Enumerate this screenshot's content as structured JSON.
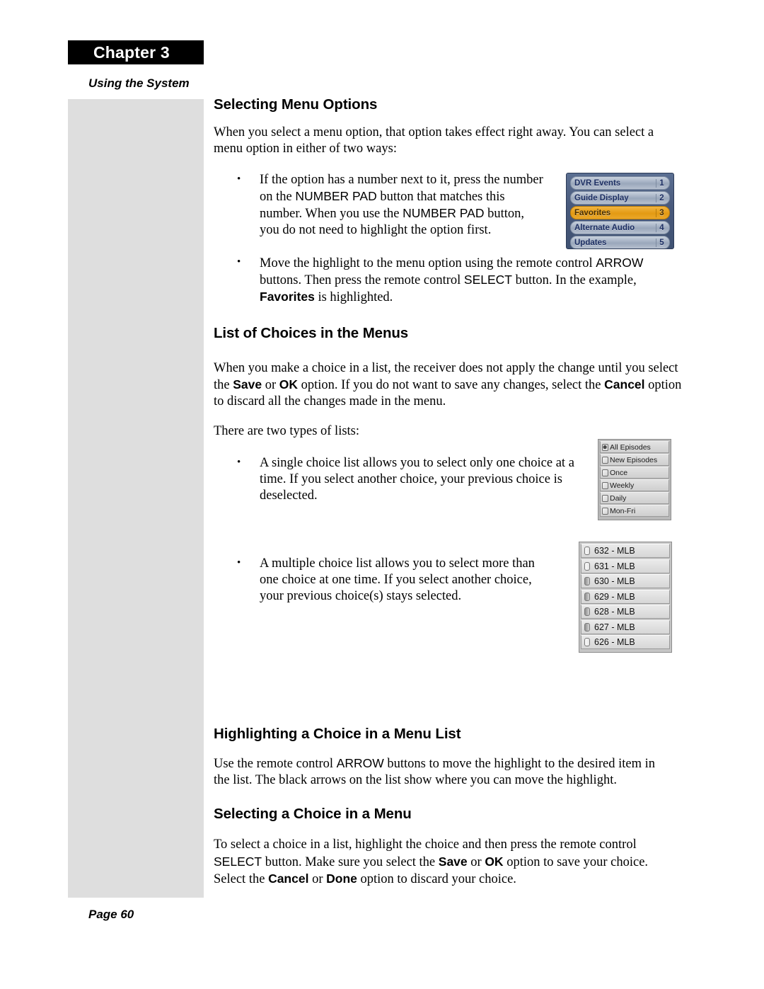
{
  "chapter": {
    "banner_label": "Chapter 3",
    "subtitle": "Using the System"
  },
  "footer": {
    "page_label": "Page 60"
  },
  "sections": {
    "selecting_menu_options": {
      "heading": "Selecting Menu Options",
      "intro": "When you select a menu option, that option takes effect right away. You can select a menu option in either of two ways:",
      "bullet1": {
        "part1": "If the option has a number next to it, press the number on the ",
        "emph1": "NUMBER PAD",
        "part2": " button that matches this number. When you use the ",
        "emph2": "NUMBER PAD",
        "part3": " button, you do not need to highlight the option first."
      },
      "bullet2": {
        "part1": "Move the highlight to the menu option using the remote control ",
        "emph1": "ARROW",
        "part2": " buttons. Then press the remote control ",
        "emph2": "SELECT",
        "part3": " button. In the example, ",
        "emph3": "Favorites",
        "part4": " is highlighted."
      }
    },
    "list_of_choices": {
      "heading": "List of Choices in the Menus",
      "para": {
        "part1": "When you make a choice in a list, the receiver does not apply the change until you select the ",
        "emph1": "Save",
        "part2": " or ",
        "emph2": "OK",
        "part3": " option. If you do not want to save any changes, select the ",
        "emph3": "Cancel",
        "part4": " option to discard all the changes made in the menu."
      },
      "two_types": "There are two types of lists:",
      "bullet1": "A single choice list allows you to select only one choice at a time. If you select another choice, your previous choice is deselected.",
      "bullet2": "A multiple choice list allows you to select more than one choice at one time. If you select another choice, your previous choice(s) stays selected."
    },
    "highlighting_choice": {
      "heading": "Highlighting a Choice in a Menu List",
      "para": {
        "part1": "Use the remote control ",
        "emph1": "ARROW",
        "part2": " buttons to move the highlight to the desired item in the list. The black arrows on the list show where you can move the highlight."
      }
    },
    "selecting_choice": {
      "heading": "Selecting a Choice in a Menu",
      "para": {
        "part1": "To select a choice in a list, highlight the choice and then press the remote control ",
        "emph1": "SELECT",
        "part2": " button. Make sure you select the ",
        "emph2": "Save",
        "part3": " or ",
        "emph3": "OK",
        "part4": " option to save your choice. Select the ",
        "emph4": "Cancel",
        "part5": " or ",
        "emph5": "Done",
        "part6": " option to discard your choice."
      }
    }
  },
  "figures": {
    "dvr_menu": {
      "highlight_color": "#e39a13",
      "background_color": "#48597b",
      "rows": [
        {
          "label": "DVR Events",
          "number": "1",
          "highlighted": false
        },
        {
          "label": "Guide Display",
          "number": "2",
          "highlighted": false
        },
        {
          "label": "Favorites",
          "number": "3",
          "highlighted": true
        },
        {
          "label": "Alternate Audio",
          "number": "4",
          "highlighted": false
        },
        {
          "label": "Updates",
          "number": "5",
          "highlighted": false
        }
      ]
    },
    "single_choice_list": {
      "rows": [
        {
          "label": "All Episodes",
          "selected": true
        },
        {
          "label": "New Episodes",
          "selected": false
        },
        {
          "label": "Once",
          "selected": false
        },
        {
          "label": "Weekly",
          "selected": false
        },
        {
          "label": "Daily",
          "selected": false
        },
        {
          "label": "Mon-Fri",
          "selected": false
        }
      ]
    },
    "multiple_choice_list": {
      "rows": [
        {
          "label": "632 - MLB",
          "selected": false
        },
        {
          "label": "631 - MLB",
          "selected": false
        },
        {
          "label": "630 - MLB",
          "selected": true
        },
        {
          "label": "629 - MLB",
          "selected": true
        },
        {
          "label": "628 - MLB",
          "selected": true
        },
        {
          "label": "627 - MLB",
          "selected": true
        },
        {
          "label": "626 - MLB",
          "selected": false
        }
      ]
    }
  }
}
